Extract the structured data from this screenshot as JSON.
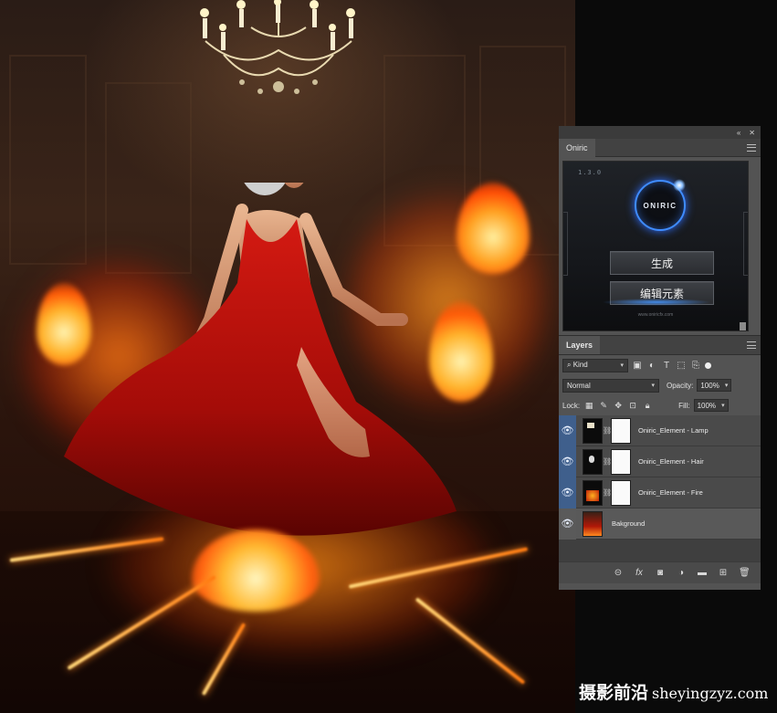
{
  "oniric": {
    "tab_label": "Oniric",
    "version": "1.3.0",
    "logo_text": "ONIRIC",
    "generate_label": "生成",
    "edit_label": "编辑元素",
    "url": "www.oniricfx.com"
  },
  "layers": {
    "tab_label": "Layers",
    "filter_kind": "Kind",
    "blend_mode": "Normal",
    "opacity_label": "Opacity:",
    "opacity_value": "100%",
    "lock_label": "Lock:",
    "fill_label": "Fill:",
    "fill_value": "100%",
    "items": [
      {
        "name": "Oniric_Element - Lamp",
        "has_mask": true,
        "visible": true
      },
      {
        "name": "Oniric_Element - Hair",
        "has_mask": true,
        "visible": true
      },
      {
        "name": "Oniric_Element - Fire",
        "has_mask": true,
        "visible": true
      },
      {
        "name": "Bakground",
        "has_mask": false,
        "visible": true,
        "selected": true
      }
    ]
  },
  "watermark": {
    "chinese": "摄影前沿",
    "domain": "sheyingzyz.com"
  },
  "icons": {
    "eye": "eye-icon",
    "link": "link-layers-icon",
    "fx": "fx-icon",
    "mask": "add-mask-icon",
    "adjustment": "adjustment-layer-icon",
    "group": "folder-icon",
    "new_layer": "new-layer-icon",
    "delete": "trash-icon"
  },
  "colors": {
    "panel_bg": "#535353",
    "tab_bar": "#424242",
    "visible_highlight": "#3f5f8c",
    "oniric_accent": "#3f8cff"
  }
}
